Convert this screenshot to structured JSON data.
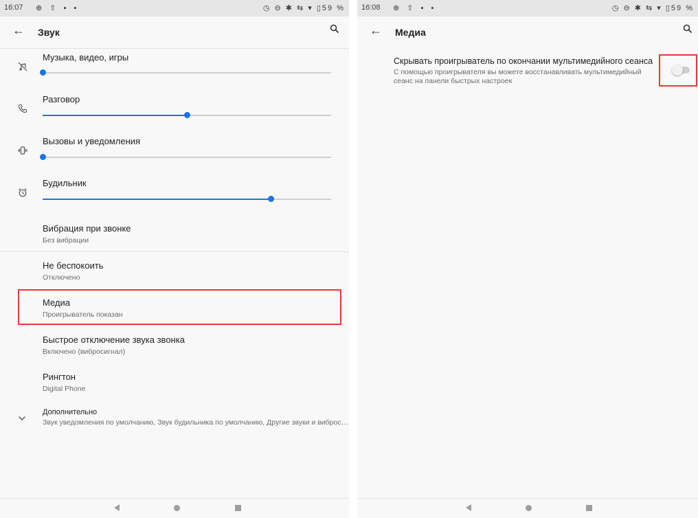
{
  "left": {
    "status": {
      "time": "16:07",
      "notifications": "⊕ ⇧ ▪ ▪",
      "right": "◷ ⊖ ✱ ⇆ ▾ ▯59 %"
    },
    "appbar": {
      "title": "Звук"
    },
    "volumes": [
      {
        "label": "Музыка, видео, игры",
        "level": 0.0,
        "icon": "music-off-icon"
      },
      {
        "label": "Разговор",
        "level": 0.5,
        "icon": "phone-icon"
      },
      {
        "label": "Вызовы и уведомления",
        "level": 0.0,
        "icon": "vibrate-icon"
      },
      {
        "label": "Будильник",
        "level": 0.79,
        "icon": "alarm-icon"
      }
    ],
    "items": [
      {
        "title": "Вибрация при звонке",
        "subtitle": "Без вибрации"
      },
      {
        "title": "Не беспокоить",
        "subtitle": "Отключено"
      },
      {
        "title": "Медиа",
        "subtitle": "Проигрыватель показан"
      },
      {
        "title": "Быстрое отключение звука звонка",
        "subtitle": "Включено (вибросигнал)"
      },
      {
        "title": "Рингтон",
        "subtitle": "Digital Phone"
      },
      {
        "title": "Дополнительно",
        "subtitle": "Звук уведомления по умолчанию, Звук будильника по умолчанию, Другие звуки и вибросигналы"
      }
    ]
  },
  "right": {
    "status": {
      "time": "16:08",
      "notifications": "⊕ ⇧ ▪ ▪",
      "right": "◷ ⊖ ✱ ⇆ ▾ ▯59 %"
    },
    "appbar": {
      "title": "Медиа"
    },
    "setting": {
      "title": "Скрывать проигрыватель по окончании мультимедийного сеанса",
      "description": "С помощью проигрывателя вы можете восстанавливать мультимедийный сеанс на панели быстрых настроек",
      "enabled": false
    }
  },
  "colors": {
    "accent": "#1a73e8",
    "highlight": "#e53935"
  }
}
